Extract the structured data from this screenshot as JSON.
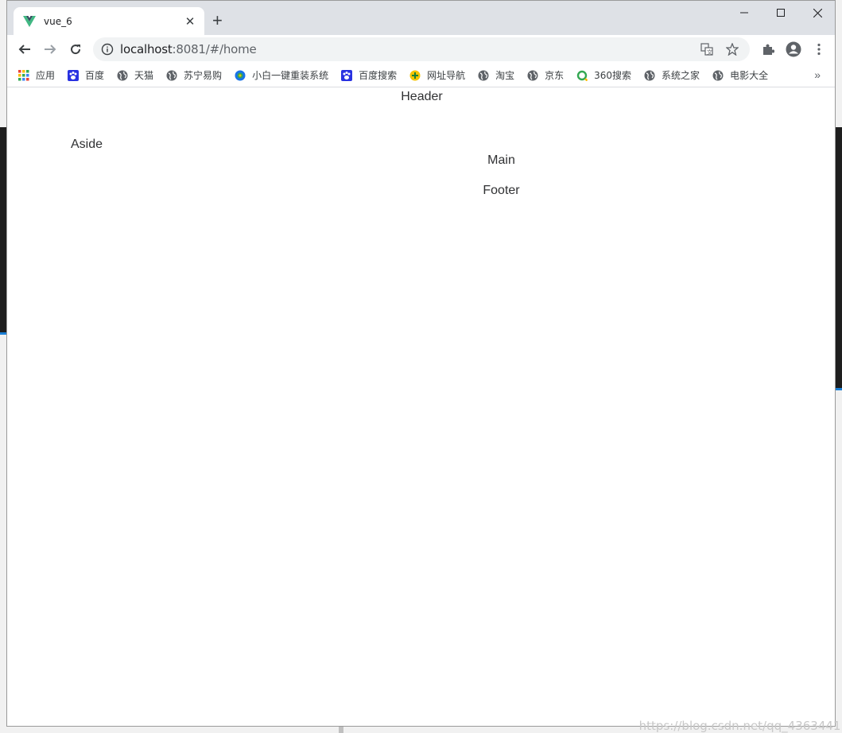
{
  "tab": {
    "title": "vue_6"
  },
  "omnibox": {
    "url_host": "localhost",
    "url_rest": ":8081/#/home"
  },
  "bookmarks": [
    {
      "label": "应用",
      "icon": "apps-grid-icon"
    },
    {
      "label": "百度",
      "icon": "baidu-paw-icon"
    },
    {
      "label": "天猫",
      "icon": "globe-icon"
    },
    {
      "label": "苏宁易购",
      "icon": "globe-icon"
    },
    {
      "label": "小白一键重装系统",
      "icon": "xiaobai-icon"
    },
    {
      "label": "百度搜索",
      "icon": "baidu-paw-icon"
    },
    {
      "label": "网址导航",
      "icon": "plus-circle-icon"
    },
    {
      "label": "淘宝",
      "icon": "globe-icon"
    },
    {
      "label": "京东",
      "icon": "globe-icon"
    },
    {
      "label": "360搜索",
      "icon": "360-search-icon"
    },
    {
      "label": "系统之家",
      "icon": "globe-icon"
    },
    {
      "label": "电影大全",
      "icon": "globe-icon"
    }
  ],
  "page": {
    "header": "Header",
    "aside": "Aside",
    "main": "Main",
    "footer": "Footer"
  },
  "watermark": "https://blog.csdn.net/qq_43634411",
  "colors": {
    "tabstrip": "#dee1e6",
    "vue_green": "#41b883",
    "vue_dark": "#35495e",
    "text": "#303133"
  }
}
